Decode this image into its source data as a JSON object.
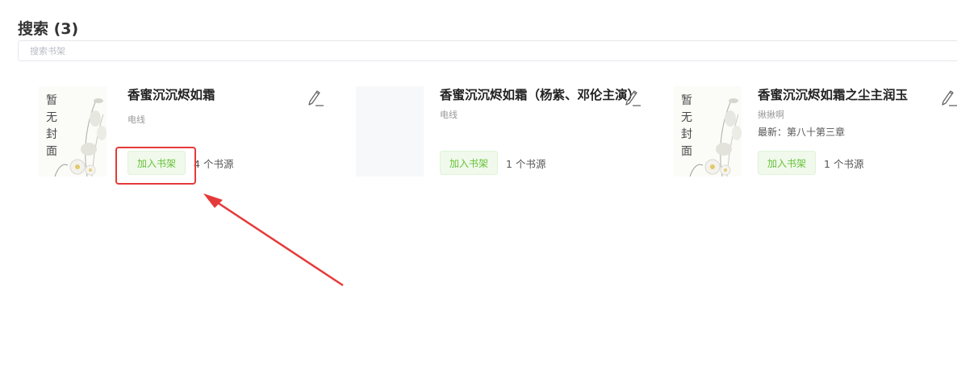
{
  "header": {
    "title": "搜索 (3)"
  },
  "search": {
    "placeholder": "搜索书架",
    "value": ""
  },
  "books": [
    {
      "name": "香蜜沉沉烬如霜",
      "author": "电线",
      "latest": "",
      "cover_text": [
        "暂",
        "无",
        "封",
        "面"
      ],
      "add_label": "加入书架",
      "sources": "4 个书源",
      "edit_icon": "pencil-icon"
    },
    {
      "name": "香蜜沉沉烬如霜（杨紫、邓伦主演）",
      "author": "电线",
      "latest": "",
      "cover_text": [],
      "add_label": "加入书架",
      "sources": "1 个书源",
      "edit_icon": "pencil-icon"
    },
    {
      "name": "香蜜沉沉烬如霜之尘主润玉",
      "author": "揪揪啊",
      "latest": "最新：第八十第三章",
      "cover_text": [
        "暂",
        "无",
        "封",
        "面"
      ],
      "add_label": "加入书架",
      "sources": "1 个书源",
      "edit_icon": "pencil-icon"
    }
  ],
  "colors": {
    "accent_green": "#67c23a",
    "annotation_red": "#e53a3a"
  }
}
